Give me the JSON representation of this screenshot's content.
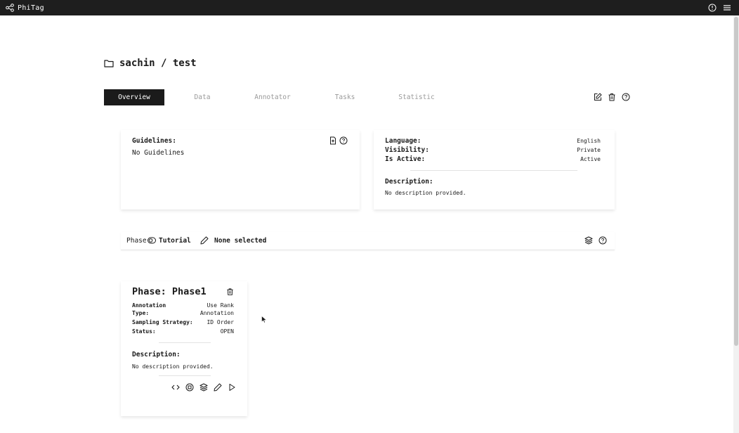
{
  "app": {
    "name": "PhiTag",
    "logo_icon": "share-nodes-icon"
  },
  "header_icons": [
    "help-circle-icon",
    "hamburger-menu-icon"
  ],
  "project": {
    "title": "sachin / test",
    "icon": "folder-icon"
  },
  "tabs": [
    {
      "label": "Overview",
      "active": true
    },
    {
      "label": "Data",
      "active": false
    },
    {
      "label": "Annotator",
      "active": false
    },
    {
      "label": "Tasks",
      "active": false
    },
    {
      "label": "Statistic",
      "active": false
    }
  ],
  "tab_actions": [
    "edit-icon",
    "trash-icon",
    "help-circle-icon"
  ],
  "guidelines": {
    "heading": "Guidelines:",
    "value": "No Guidelines",
    "icons": [
      "file-add-icon",
      "help-circle-icon"
    ]
  },
  "meta": {
    "language_label": "Language:",
    "language_value": "English",
    "visibility_label": "Visibility:",
    "visibility_value": "Private",
    "active_label": "Is Active:",
    "active_value": "Active",
    "description_label": "Description:",
    "description_value": "No description provided."
  },
  "phasebar": {
    "phase_label": "Phase",
    "tutorial_label": "Tutorial",
    "selection_label": "None selected",
    "icons": [
      "toggle-icon",
      "pencil-icon",
      "layers-icon",
      "help-circle-icon"
    ]
  },
  "phase": {
    "title": "Phase: Phase1",
    "annotation_type_label_1": "Annotation",
    "annotation_type_label_2": "Type:",
    "annotation_type_value_1": "Use Rank",
    "annotation_type_value_2": "Annotation",
    "sampling_label": "Sampling Strategy:",
    "sampling_value": "ID Order",
    "status_label": "Status:",
    "status_value": "OPEN",
    "description_label": "Description:",
    "description_value": "No description provided.",
    "action_icons": [
      "code-icon",
      "stop-circle-icon",
      "layers-icon",
      "pencil-icon",
      "play-icon"
    ]
  },
  "colors": {
    "topbar": "#1e1e1e",
    "active_tab": "#1b1b1b",
    "inactive_tab_text": "#9a9a9a"
  }
}
